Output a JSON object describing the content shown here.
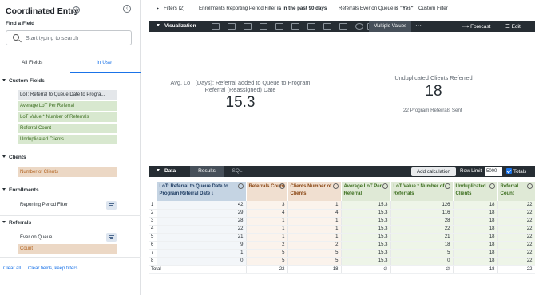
{
  "sidebar": {
    "title": "Coordinated Entry",
    "info_icon": "info-icon",
    "collapse_icon": "collapse-left-icon",
    "find_label": "Find a Field",
    "search_placeholder": "Start typing to search",
    "tabs": [
      {
        "label": "All Fields",
        "active": false
      },
      {
        "label": "In Use",
        "active": true
      }
    ],
    "groups": [
      {
        "label": "Custom Fields",
        "fields": [
          {
            "label": "LoT: Referral to Queue Date to Program Referral Date",
            "display": "LoT: Referral to Queue Date to Progra...",
            "kind": "dimension"
          },
          {
            "label": "Average LoT Per Referral",
            "kind": "calc"
          },
          {
            "label": "LoT Value * Number of Referrals",
            "kind": "calc"
          },
          {
            "label": "Referral Count",
            "kind": "calc"
          },
          {
            "label": "Unduplicated Clients",
            "kind": "calc"
          }
        ]
      },
      {
        "label": "Clients",
        "fields": [
          {
            "label": "Number of Clients",
            "kind": "measure"
          }
        ]
      },
      {
        "label": "Enrollments",
        "fields": [
          {
            "label": "Reporting Period Filter",
            "kind": "filter"
          }
        ]
      },
      {
        "label": "Referrals",
        "fields": [
          {
            "label": "Ever on Queue",
            "kind": "filter"
          },
          {
            "label": "Count",
            "kind": "measure"
          }
        ]
      }
    ],
    "footer_links": [
      "Clear all",
      "Clear fields, keep filters"
    ]
  },
  "filters_bar": {
    "toggle": "Filters (2)",
    "filter_1": {
      "name": "Enrollments Reporting Period Filter",
      "op": "is in the past 90 days"
    },
    "filter_2": {
      "name": "Referrals Ever on Queue",
      "op": "is \"Yes\""
    },
    "custom": "Custom Filter"
  },
  "visualization_bar": {
    "label": "Visualization",
    "multiple_values": "Multiple Values",
    "more": "···",
    "forecast": "Forecast",
    "edit": "Edit",
    "icons": [
      "table-icon",
      "column-chart-icon",
      "bar-chart-icon",
      "scatter-icon",
      "line-icon",
      "area-icon",
      "pie-icon",
      "map-icon",
      "donut-icon",
      "single-value-icon",
      "pin-icon",
      "number-icon"
    ]
  },
  "single_values": [
    {
      "label": "Avg. LoT (Days): Referral added to Queue to Program Referral (Reassigned) Date",
      "value": "15.3"
    },
    {
      "label": "Unduplicated Clients Referred",
      "value": "18",
      "sub_value": "22",
      "sub_label": "Program Referrals Sent"
    }
  ],
  "data_bar": {
    "label": "Data",
    "tabs": [
      "Results",
      "SQL"
    ],
    "add_calc": "Add calculation",
    "row_limit_label": "Row Limit",
    "row_limit": "5000",
    "totals_label": "Totals",
    "totals_checked": true
  },
  "table": {
    "columns": [
      {
        "label": "",
        "kind": "index"
      },
      {
        "label": "LoT: Referral to Queue Date to Program Referral Date",
        "kind": "dimension",
        "sorted": "desc"
      },
      {
        "label": "Referrals Count",
        "kind": "measure"
      },
      {
        "label": "Clients Number of Clients",
        "kind": "measure"
      },
      {
        "label": "Average LoT Per Referral",
        "kind": "calc"
      },
      {
        "label": "LoT Value * Number of Referrals",
        "kind": "calc"
      },
      {
        "label": "Unduplicated Clients",
        "kind": "calc"
      },
      {
        "label": "Referral Count",
        "kind": "calc"
      }
    ],
    "rows": [
      [
        "1",
        "42",
        "3",
        "1",
        "15.3",
        "126",
        "18",
        "22"
      ],
      [
        "2",
        "29",
        "4",
        "4",
        "15.3",
        "116",
        "18",
        "22"
      ],
      [
        "3",
        "28",
        "1",
        "1",
        "15.3",
        "28",
        "18",
        "22"
      ],
      [
        "4",
        "22",
        "1",
        "1",
        "15.3",
        "22",
        "18",
        "22"
      ],
      [
        "5",
        "21",
        "1",
        "1",
        "15.3",
        "21",
        "18",
        "22"
      ],
      [
        "6",
        "9",
        "2",
        "2",
        "15.3",
        "18",
        "18",
        "22"
      ],
      [
        "7",
        "1",
        "5",
        "5",
        "15.3",
        "5",
        "18",
        "22"
      ],
      [
        "8",
        "0",
        "5",
        "5",
        "15.3",
        "0",
        "18",
        "22"
      ]
    ],
    "totals": [
      "Total",
      "",
      "22",
      "18",
      "∅",
      "∅",
      "18",
      "22"
    ]
  },
  "colors": {
    "dimension_header": "#c5d4e3",
    "measure_header": "#f0dfd0",
    "calc_header": "#dfe9d6",
    "dark_bar": "#262d33",
    "accent": "#1a73e8"
  }
}
